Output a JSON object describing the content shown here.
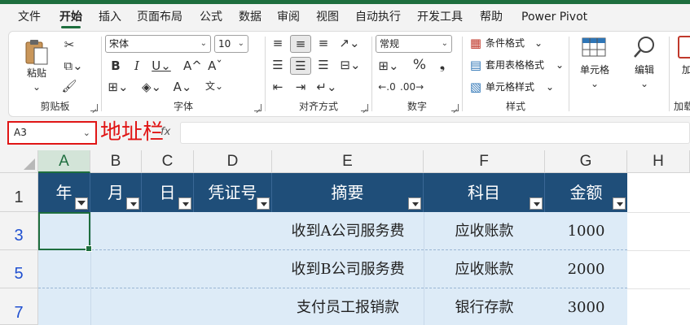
{
  "menu": {
    "tabs": [
      "文件",
      "开始",
      "插入",
      "页面布局",
      "公式",
      "数据",
      "审阅",
      "视图",
      "自动执行",
      "开发工具",
      "帮助",
      "Power Pivot"
    ],
    "active": "开始"
  },
  "ribbon": {
    "clipboard": {
      "label": "剪贴板",
      "paste_label": "粘贴"
    },
    "font": {
      "label": "字体",
      "font_name": "宋体",
      "font_size": "10"
    },
    "alignment": {
      "label": "对齐方式"
    },
    "number": {
      "label": "数字",
      "format": "常规"
    },
    "styles": {
      "label": "样式",
      "conditional": "条件格式",
      "table_format": "套用表格格式",
      "cell_styles": "单元格样式"
    },
    "cells": {
      "label": "单元格"
    },
    "editing": {
      "label": "编辑"
    },
    "addins": {
      "label": "加载",
      "label_cut": "加"
    }
  },
  "formula_bar": {
    "name_box": "A3",
    "annotation": "地址栏",
    "fx": "fx"
  },
  "sheet": {
    "columns": [
      "A",
      "B",
      "C",
      "D",
      "E",
      "F",
      "G",
      "H"
    ],
    "selected_column": "A",
    "rows": [
      "1",
      "3",
      "5",
      "7"
    ],
    "header_row": [
      "年",
      "月",
      "日",
      "凭证号",
      "摘要",
      "科目",
      "金额"
    ],
    "data_rows": [
      {
        "summary": "收到A公司服务费",
        "account": "应收账款",
        "amount": "1000"
      },
      {
        "summary": "收到B公司服务费",
        "account": "应收账款",
        "amount": "2000"
      },
      {
        "summary": "支付员工报销款",
        "account": "银行存款",
        "amount": "3000"
      }
    ]
  }
}
